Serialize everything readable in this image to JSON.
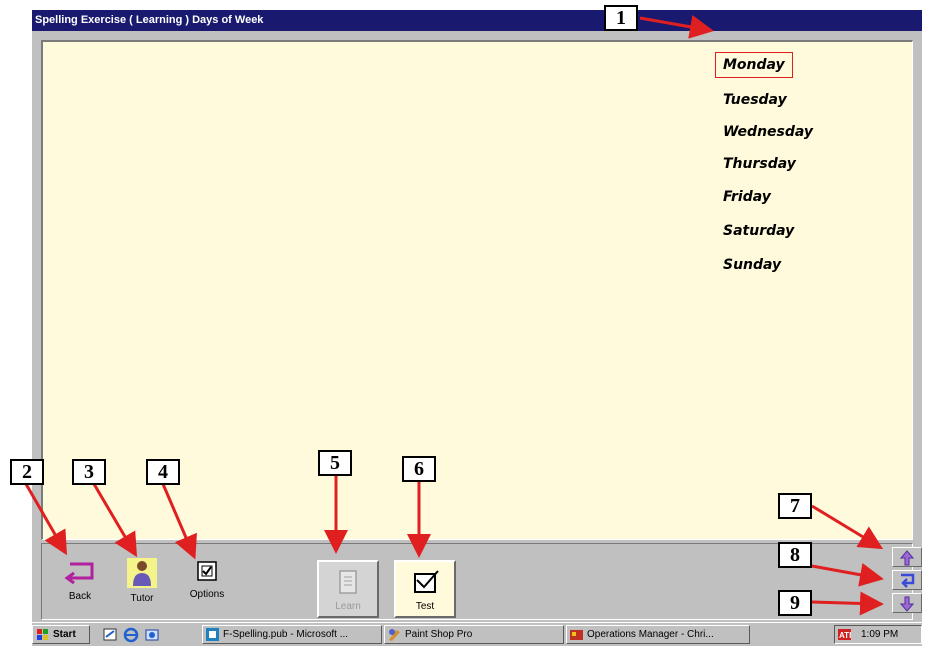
{
  "window": {
    "title": "Spelling Exercise ( Learning )   Days of Week",
    "colors": {
      "title_bg": "#191970",
      "content_bg": "#fffadb",
      "selection_border": "#e02020"
    }
  },
  "word_list": {
    "items": [
      "Monday",
      "Tuesday",
      "Wednesday",
      "Thursday",
      "Friday",
      "Saturday",
      "Sunday"
    ],
    "selected_index": 0
  },
  "toolbar": {
    "back_label": "Back",
    "tutor_label": "Tutor",
    "options_label": "Options",
    "learn_label": "Learn",
    "test_label": "Test",
    "nav_icons": [
      "arrow-up-icon",
      "return-icon",
      "arrow-down-icon"
    ]
  },
  "taskbar": {
    "start_label": "Start",
    "tasks": [
      "F-Spelling.pub - Microsoft ...",
      "Paint Shop Pro",
      "Operations Manager - Chri..."
    ],
    "clock": "1:09 PM"
  },
  "callouts": [
    "1",
    "2",
    "3",
    "4",
    "5",
    "6",
    "7",
    "8",
    "9"
  ],
  "annotation_color": "#e02020"
}
